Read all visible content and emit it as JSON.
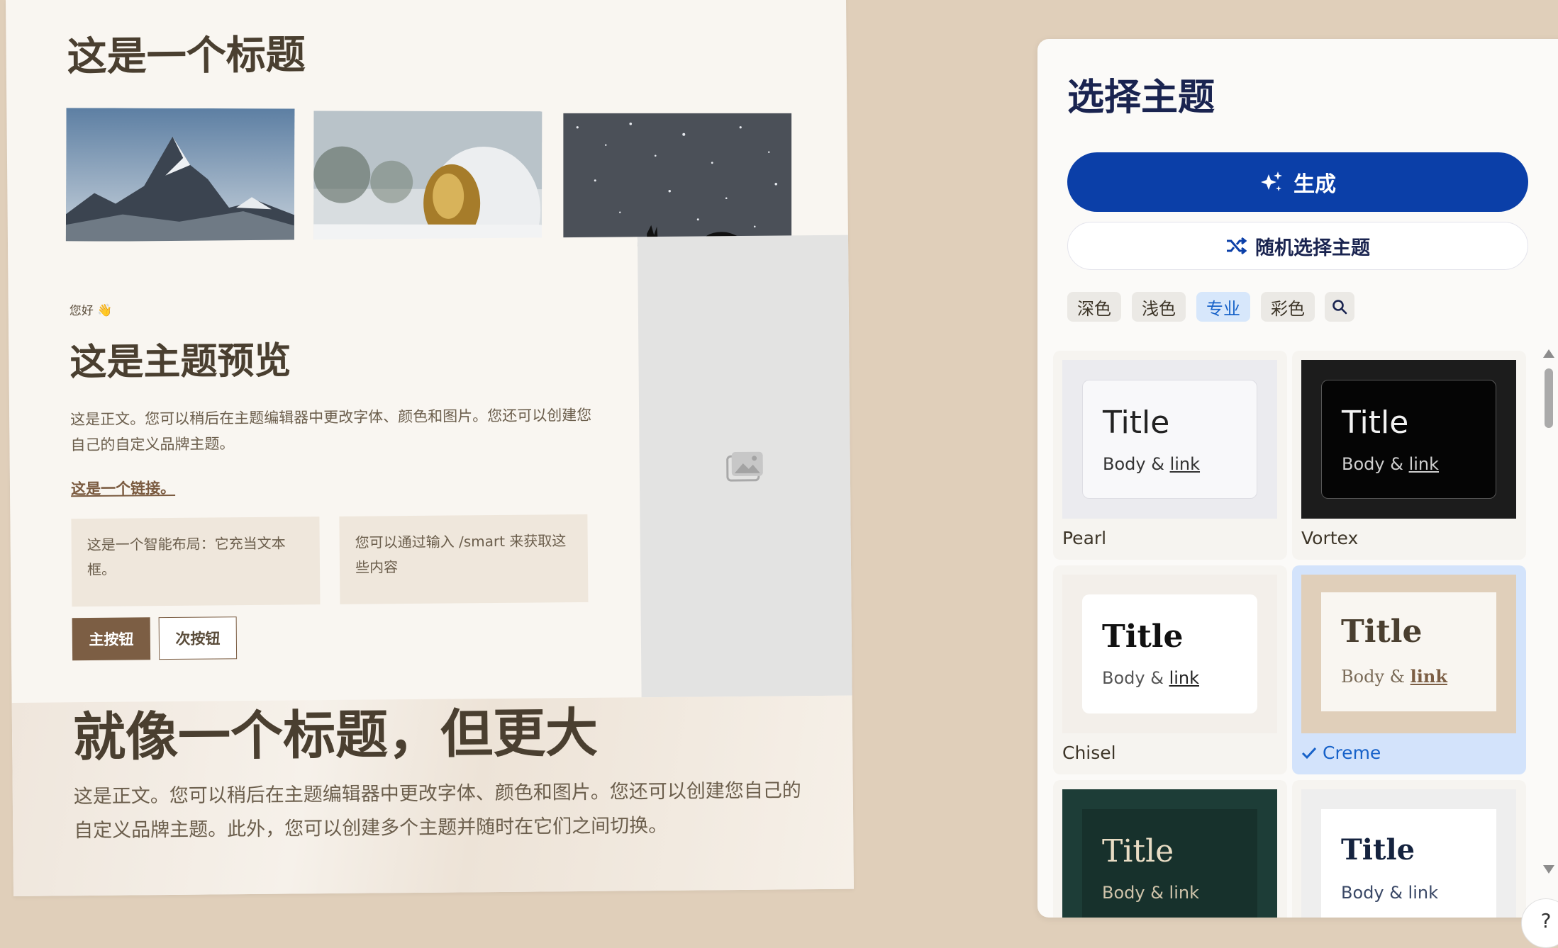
{
  "preview": {
    "title": "这是一个标题",
    "greeting": "您好 👋",
    "heading": "这是主题预览",
    "body": "这是正文。您可以稍后在主题编辑器中更改字体、颜色和图片。您还可以创建您自己的自定义品牌主题。",
    "link": "这是一个链接。",
    "smart_box_1": "这是一个智能布局：它充当文本框。",
    "smart_box_2": "您可以通过输入 /smart 来获取这些内容",
    "primary_button": "主按钮",
    "secondary_button": "次按钮",
    "big_heading": "就像一个标题，但更大",
    "big_body": "这是正文。您可以稍后在主题编辑器中更改字体、颜色和图片。您还可以创建您自己的自定义品牌主题。此外，您可以创建多个主题并随时在它们之间切换。"
  },
  "panel": {
    "title": "选择主题",
    "generate_label": "生成",
    "random_label": "随机选择主题",
    "filters": [
      "深色",
      "浅色",
      "专业",
      "彩色"
    ],
    "active_filter": "专业",
    "themes": [
      {
        "name": "Pearl",
        "title": "Title",
        "body": "Body & ",
        "link": "link",
        "bg": "#ebebef",
        "inner": "#f8f8fa",
        "text": "#222222",
        "selected": false
      },
      {
        "name": "Vortex",
        "title": "Title",
        "body": "Body & ",
        "link": "link",
        "bg": "#1c1c1c",
        "inner": "#050505",
        "text": "#f2f2f2",
        "selected": false
      },
      {
        "name": "Chisel",
        "title": "Title",
        "body": "Body & ",
        "link": "link",
        "bg": "#f3efea",
        "inner": "#ffffff",
        "text": "#111111",
        "selected": false
      },
      {
        "name": "Creme",
        "title": "Title",
        "body": "Body & ",
        "link": "link",
        "bg": "#e0cfba",
        "inner": "#f9f6f1",
        "text": "#4a3f30",
        "selected": true
      },
      {
        "name": "",
        "title": "Title",
        "body": "Body & link",
        "link": "",
        "bg": "#1d3d37",
        "inner": "#17312c",
        "text": "#e8dcc4",
        "selected": false
      },
      {
        "name": "",
        "title": "Title",
        "body": "Body & link",
        "link": "",
        "bg": "#eeeeee",
        "inner": "#ffffff",
        "text": "#15233f",
        "selected": false
      }
    ]
  },
  "colors": {
    "accent": "#0b3fa8",
    "page_bg": "#e0cfba",
    "creme_button": "#7c5e44"
  },
  "icons": {
    "generate": "sparkle-icon",
    "random": "shuffle-icon",
    "search": "search-icon",
    "check": "check-icon",
    "image_placeholder": "image-icon",
    "help": "?"
  }
}
